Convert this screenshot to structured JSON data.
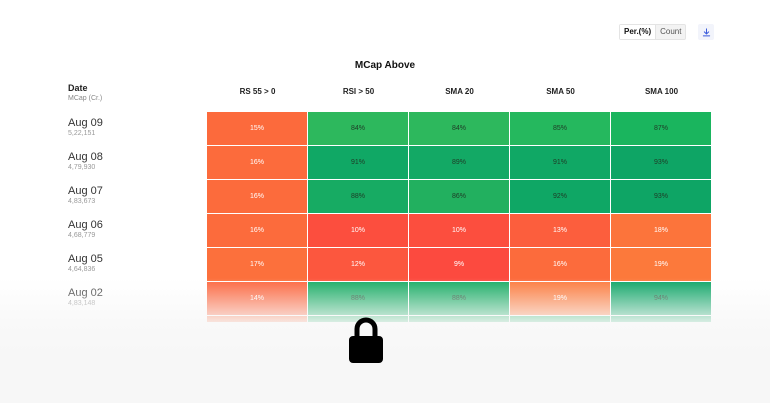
{
  "toolbar": {
    "per_label": "Per.(%)",
    "count_label": "Count",
    "download_icon": "download-icon"
  },
  "panel": {
    "title": "MCap Above"
  },
  "table": {
    "date_header": "Date",
    "mcap_header": "MCap (Cr.)",
    "columns": [
      "RS 55 > 0",
      "RSI > 50",
      "SMA 20",
      "SMA 50",
      "SMA 100"
    ],
    "rows": [
      {
        "date": "Aug 09",
        "mcap": "5,22,151",
        "values": [
          "15%",
          "84%",
          "84%",
          "85%",
          "87%"
        ],
        "colors": [
          "#fc6a3c",
          "#2db85d",
          "#2db85d",
          "#25b85e",
          "#1ab55e"
        ]
      },
      {
        "date": "Aug 08",
        "mcap": "4,79,930",
        "values": [
          "16%",
          "91%",
          "89%",
          "91%",
          "93%"
        ],
        "colors": [
          "#fc6b3c",
          "#10a865",
          "#13a965",
          "#10a865",
          "#0ea565"
        ]
      },
      {
        "date": "Aug 07",
        "mcap": "4,83,673",
        "values": [
          "16%",
          "88%",
          "86%",
          "92%",
          "93%"
        ],
        "colors": [
          "#fc6b3c",
          "#17ab63",
          "#22b05f",
          "#0fa765",
          "#0ea565"
        ]
      },
      {
        "date": "Aug 06",
        "mcap": "4,68,779",
        "values": [
          "16%",
          "10%",
          "10%",
          "13%",
          "18%"
        ],
        "colors": [
          "#fc6b3c",
          "#fc4e3e",
          "#fc4e3e",
          "#fc5e3d",
          "#fc743b"
        ]
      },
      {
        "date": "Aug 05",
        "mcap": "4,64,836",
        "values": [
          "17%",
          "12%",
          "9%",
          "16%",
          "19%"
        ],
        "colors": [
          "#fc703c",
          "#fc573e",
          "#fc4a3f",
          "#fc6b3c",
          "#fc793b"
        ]
      },
      {
        "date": "Aug 02",
        "mcap": "4,83,148",
        "values": [
          "14%",
          "88%",
          "88%",
          "19%",
          "94%"
        ],
        "colors": [
          "#fc653d",
          "#17ab63",
          "#17ab63",
          "#fc793b",
          "#0ca465"
        ]
      },
      {
        "date": "",
        "mcap": "",
        "values": [
          "",
          "",
          "",
          "",
          ""
        ],
        "colors": [
          "#fc6b3c",
          "#1aad62",
          "#1aad62",
          "#1aad62",
          "#10a865"
        ]
      }
    ]
  },
  "overlay": {
    "icon": "lock-icon"
  }
}
